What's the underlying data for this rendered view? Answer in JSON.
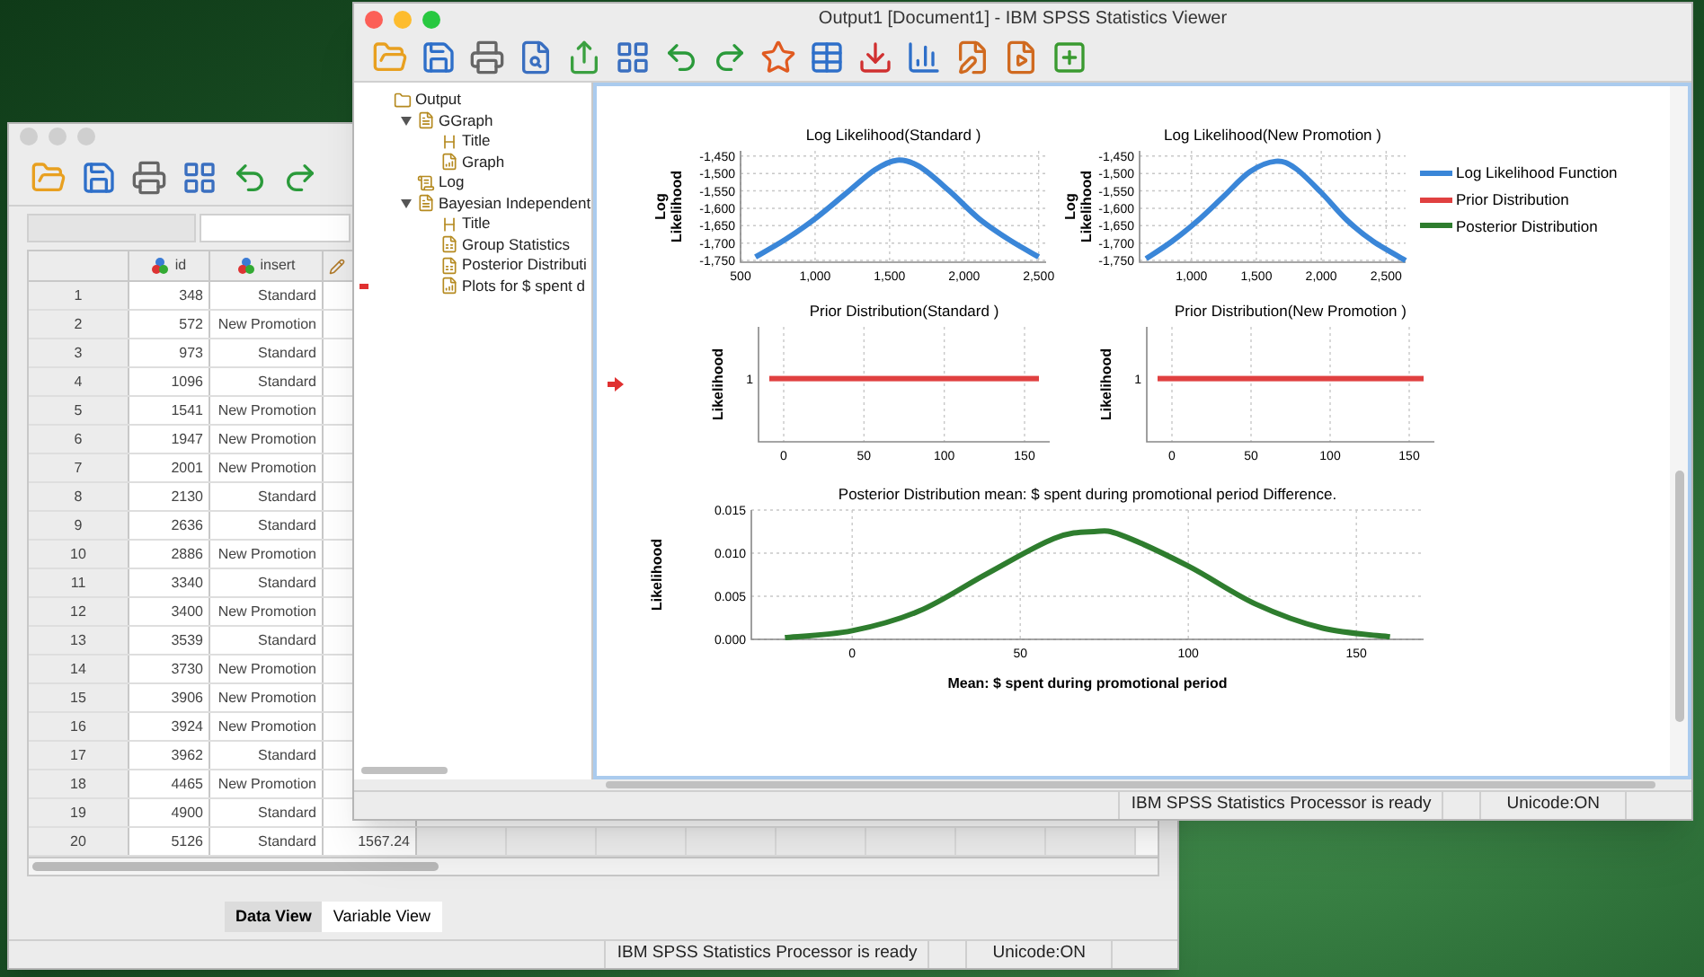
{
  "data_window": {
    "active": false,
    "table": {
      "columns": [
        "id",
        "insert"
      ],
      "rows": [
        {
          "number": "1",
          "cells": [
            "348",
            "Standard"
          ]
        },
        {
          "number": "2",
          "cells": [
            "572",
            "New Promotion"
          ]
        },
        {
          "number": "3",
          "cells": [
            "973",
            "Standard"
          ]
        },
        {
          "number": "4",
          "cells": [
            "1096",
            "Standard"
          ]
        },
        {
          "number": "5",
          "cells": [
            "1541",
            "New Promotion"
          ]
        },
        {
          "number": "6",
          "cells": [
            "1947",
            "New Promotion"
          ]
        },
        {
          "number": "7",
          "cells": [
            "2001",
            "New Promotion"
          ]
        },
        {
          "number": "8",
          "cells": [
            "2130",
            "Standard"
          ]
        },
        {
          "number": "9",
          "cells": [
            "2636",
            "Standard"
          ]
        },
        {
          "number": "10",
          "cells": [
            "2886",
            "New Promotion"
          ]
        },
        {
          "number": "11",
          "cells": [
            "3340",
            "Standard"
          ]
        },
        {
          "number": "12",
          "cells": [
            "3400",
            "New Promotion"
          ]
        },
        {
          "number": "13",
          "cells": [
            "3539",
            "Standard"
          ]
        },
        {
          "number": "14",
          "cells": [
            "3730",
            "New Promotion"
          ]
        },
        {
          "number": "15",
          "cells": [
            "3906",
            "New Promotion"
          ]
        },
        {
          "number": "16",
          "cells": [
            "3924",
            "New Promotion"
          ]
        },
        {
          "number": "17",
          "cells": [
            "3962",
            "Standard"
          ]
        },
        {
          "number": "18",
          "cells": [
            "4465",
            "New Promotion"
          ]
        },
        {
          "number": "19",
          "cells": [
            "4900",
            "Standard"
          ]
        },
        {
          "number": "20",
          "cells": [
            "5126",
            "Standard",
            "1567.24"
          ]
        }
      ]
    },
    "tabs": [
      {
        "label": "Data View",
        "selected": true
      },
      {
        "label": "Variable View",
        "selected": false
      }
    ],
    "status_bar": [
      "IBM SPSS Statistics Processor is ready",
      "Unicode:ON"
    ]
  },
  "viewer_window": {
    "title": "Output1 [Document1] - IBM SPSS Statistics Viewer",
    "active": true,
    "outline": [
      {
        "label": "Output",
        "kind": "root",
        "current": false,
        "children": [
          {
            "label": "GGraph",
            "kind": "folder",
            "expanded": true,
            "current": false,
            "children": [
              {
                "label": "Title",
                "kind": "title",
                "current": false
              },
              {
                "label": "Graph",
                "kind": "graph",
                "current": false
              }
            ]
          },
          {
            "label": "Log",
            "kind": "log",
            "current": false
          },
          {
            "label": "Bayesian Independent",
            "kind": "folder",
            "expanded": true,
            "current": false,
            "children": [
              {
                "label": "Title",
                "kind": "title",
                "current": false
              },
              {
                "label": "Group Statistics",
                "kind": "table",
                "current": false
              },
              {
                "label": "Posterior Distributi",
                "kind": "table",
                "current": false
              },
              {
                "label": "Plots for $ spent d",
                "kind": "graph",
                "current": true
              }
            ]
          }
        ]
      }
    ],
    "content": {
      "legend": [
        {
          "label": "Log Likelihood Function",
          "color": "#3a86d8"
        },
        {
          "label": "Prior Distribution",
          "color": "#e04040"
        },
        {
          "label": "Posterior Distribution",
          "color": "#2e7d2e"
        }
      ],
      "charts": [
        {
          "chart_data": {
            "type": "line",
            "title": "Log Likelihood(Standard )",
            "ylabel": "Log Likelihood",
            "xlim": [
              500,
              2550
            ],
            "ylim": [
              -1755,
              -1435
            ],
            "xticks": [
              {
                "value": 500,
                "label": "500"
              },
              {
                "value": 1000,
                "label": "1,000"
              },
              {
                "value": 1500,
                "label": "1,500"
              },
              {
                "value": 2000,
                "label": "2,000"
              },
              {
                "value": 2500,
                "label": "2,500"
              }
            ],
            "yticks": [
              {
                "value": -1750,
                "label": "-1,750"
              },
              {
                "value": -1700,
                "label": "-1,700"
              },
              {
                "value": -1650,
                "label": "-1,650"
              },
              {
                "value": -1600,
                "label": "-1,600"
              },
              {
                "value": -1550,
                "label": "-1,550"
              },
              {
                "value": -1500,
                "label": "-1,500"
              },
              {
                "value": -1450,
                "label": "-1,450"
              }
            ],
            "x": [
              600,
              800,
              1000,
              1200,
              1400,
              1550,
              1700,
              1900,
              2100,
              2300,
              2500
            ],
            "grid": true,
            "series": [
              {
                "color": "#3a86d8",
                "values": [
                  -1740,
                  -1690,
                  -1630,
                  -1560,
                  -1490,
                  -1462,
                  -1480,
                  -1550,
                  -1630,
                  -1690,
                  -1740
                ]
              }
            ]
          }
        },
        {
          "chart_data": {
            "type": "line",
            "title": "Log Likelihood(New Promotion )",
            "ylabel": "Log Likelihood",
            "xlim": [
              600,
              2650
            ],
            "ylim": [
              -1755,
              -1435
            ],
            "xticks": [
              {
                "value": 1000,
                "label": "1,000"
              },
              {
                "value": 1500,
                "label": "1,500"
              },
              {
                "value": 2000,
                "label": "2,000"
              },
              {
                "value": 2500,
                "label": "2,500"
              }
            ],
            "yticks": [
              {
                "value": -1750,
                "label": "-1,750"
              },
              {
                "value": -1700,
                "label": "-1,700"
              },
              {
                "value": -1650,
                "label": "-1,650"
              },
              {
                "value": -1600,
                "label": "-1,600"
              },
              {
                "value": -1550,
                "label": "-1,550"
              },
              {
                "value": -1500,
                "label": "-1,500"
              },
              {
                "value": -1450,
                "label": "-1,450"
              }
            ],
            "x": [
              650,
              850,
              1050,
              1250,
              1450,
              1650,
              1800,
              2000,
              2200,
              2400,
              2650
            ],
            "grid": true,
            "series": [
              {
                "color": "#3a86d8",
                "values": [
                  -1745,
                  -1695,
                  -1635,
                  -1565,
                  -1495,
                  -1465,
                  -1485,
                  -1555,
                  -1635,
                  -1695,
                  -1750
                ]
              }
            ]
          }
        },
        {
          "plot": {
            "title": "Prior Distribution(Standard )",
            "ylabel": "Likelihood",
            "x_tick_labels": [
              "0",
              "50",
              "100",
              "150"
            ],
            "y_tick_label": "1",
            "color": "#e04040"
          }
        },
        {
          "plot": {
            "title": "Prior Distribution(New Promotion )",
            "ylabel": "Likelihood",
            "x_tick_labels": [
              "0",
              "50",
              "100",
              "150"
            ],
            "y_tick_label": "1",
            "color": "#e04040"
          }
        },
        {
          "chart_data": {
            "type": "line",
            "title": "Posterior Distribution mean: $ spent during promotional period Difference.",
            "xlabel": "Mean: $ spent during promotional period",
            "ylabel": "Likelihood",
            "xlim": [
              -30,
              170
            ],
            "ylim": [
              0,
              0.015
            ],
            "xticks": [
              0,
              50,
              100,
              150
            ],
            "yticks": [
              {
                "value": 0,
                "label": "0.000"
              },
              {
                "value": 0.005,
                "label": "0.005"
              },
              {
                "value": 0.01,
                "label": "0.010"
              },
              {
                "value": 0.015,
                "label": "0.015"
              }
            ],
            "x": [
              -20,
              0,
              20,
              40,
              60,
              72,
              80,
              100,
              120,
              140,
              160
            ],
            "grid": true,
            "series": [
              {
                "color": "#2e7d2e",
                "values": [
                  0.0002,
                  0.001,
                  0.0033,
                  0.0076,
                  0.0117,
                  0.0125,
                  0.0121,
                  0.0085,
                  0.0041,
                  0.0013,
                  0.0003
                ]
              }
            ]
          }
        }
      ]
    },
    "status_bar": [
      "IBM SPSS Statistics Processor is ready",
      "Unicode:ON"
    ]
  }
}
